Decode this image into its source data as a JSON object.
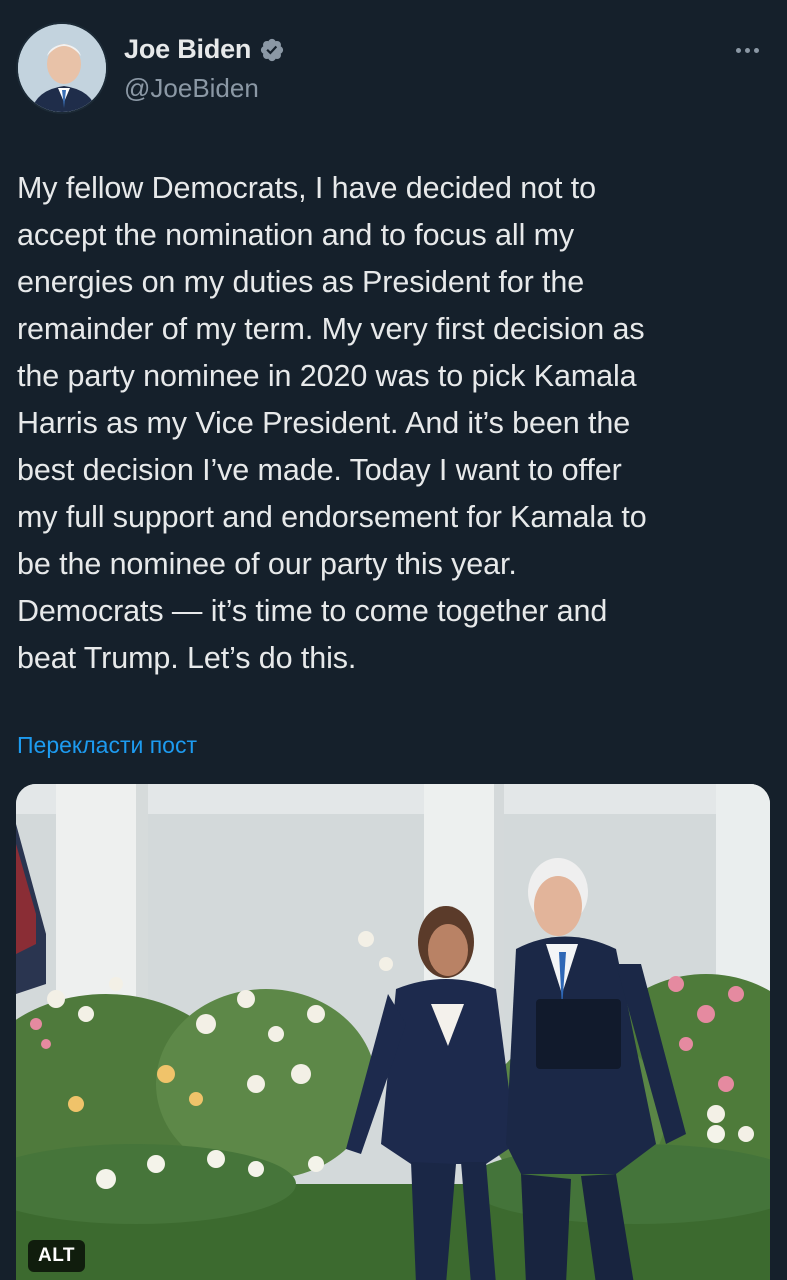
{
  "tweet": {
    "author": {
      "name": "Joe Biden",
      "handle": "@JoeBiden",
      "verified_icon": "verified-badge-icon"
    },
    "more_icon": "more-options-icon",
    "text": "My fellow Democrats, I have decided not to\naccept the nomination and to focus all my\nenergies on my duties as President for the\nremainder of my term. My very first decision as\nthe party nominee in 2020 was to pick Kamala\nHarris as my Vice President. And it’s been the\nbest decision I’ve made. Today I want to offer\nmy full support and endorsement for Kamala to\nbe the nominee of our party this year.\nDemocrats — it’s time to come together and\nbeat Trump. Let’s do this.",
    "translate_label": "Перекласти пост",
    "media": {
      "alt_badge": "ALT"
    }
  },
  "colors": {
    "background": "#15202b",
    "text_primary": "#e7e9ea",
    "text_secondary": "#8b98a5",
    "accent": "#1d9bf0"
  }
}
